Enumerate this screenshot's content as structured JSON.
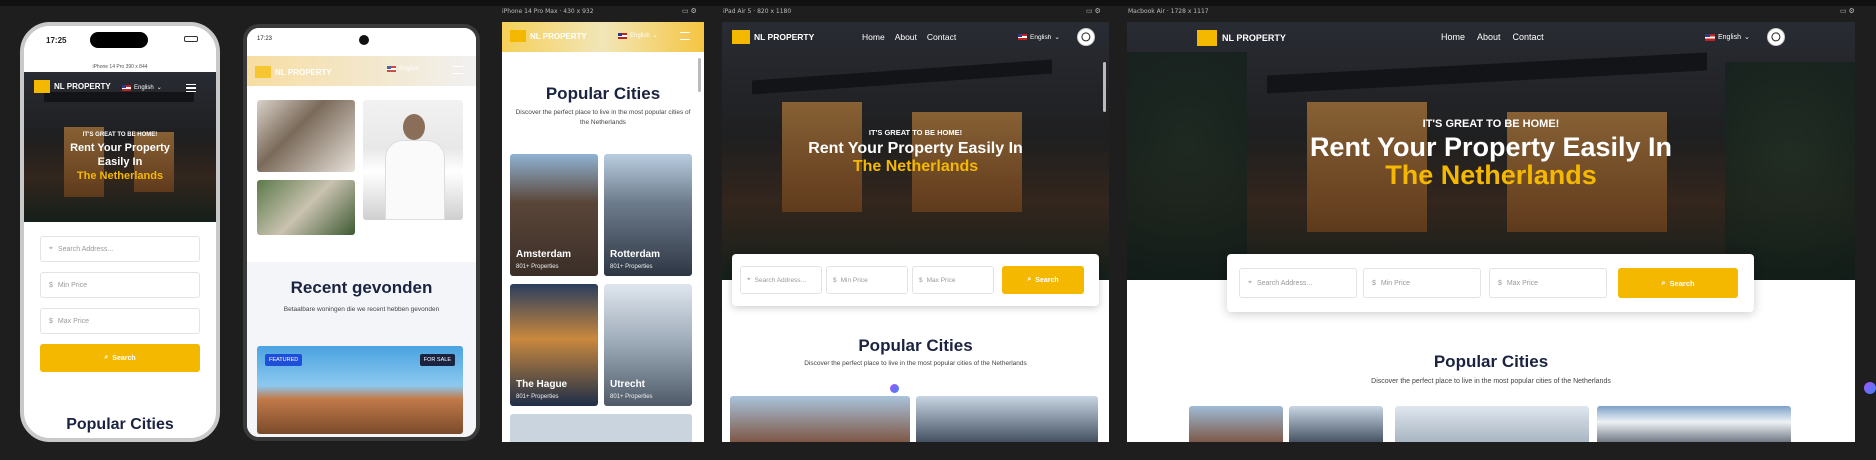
{
  "frames": {
    "iphone14pro": {
      "label": "iPhone 14 Pro",
      "size": "390 x 844",
      "time": "17:25"
    },
    "android": {
      "time": "17:23"
    },
    "iphone14promax": {
      "label": "iPhone 14 Pro Max",
      "size": "430 x 932"
    },
    "ipadair": {
      "label": "iPad Air 5",
      "size": "820 x 1180"
    },
    "macbook": {
      "label": "Macbook Air",
      "size": "1728 x 1117"
    }
  },
  "brand": {
    "name": "NL PROPERTY"
  },
  "nav": {
    "home": "Home",
    "about": "About",
    "contact": "Contact"
  },
  "language": {
    "selected": "English"
  },
  "hero": {
    "tagline": "IT'S GREAT TO BE HOME!",
    "title_line1": "Rent Your Property Easily In",
    "title_mobile_1": "Rent Your Property",
    "title_mobile_2": "Easily In",
    "highlight": "The Netherlands"
  },
  "search": {
    "address_placeholder": "Search Address...",
    "min_price": "Min Price",
    "max_price": "Max Price",
    "button": "Search"
  },
  "popular": {
    "title": "Popular Cities",
    "subtitle": "Discover the perfect place to live in the most popular cities of the Netherlands",
    "cities": [
      {
        "name": "Amsterdam",
        "count": "801+ Properties"
      },
      {
        "name": "Rotterdam",
        "count": "801+ Properties"
      },
      {
        "name": "The Hague",
        "count": "801+ Properties"
      },
      {
        "name": "Utrecht",
        "count": "801+ Properties"
      }
    ]
  },
  "recent": {
    "title": "Recent gevonden",
    "subtitle": "Betaalbare woningen die we recent hebben gevonden",
    "badge_featured": "FEATURED",
    "badge_sale": "FOR SALE"
  },
  "colors": {
    "accent": "#f5b800",
    "background": "#1e1e1e"
  }
}
